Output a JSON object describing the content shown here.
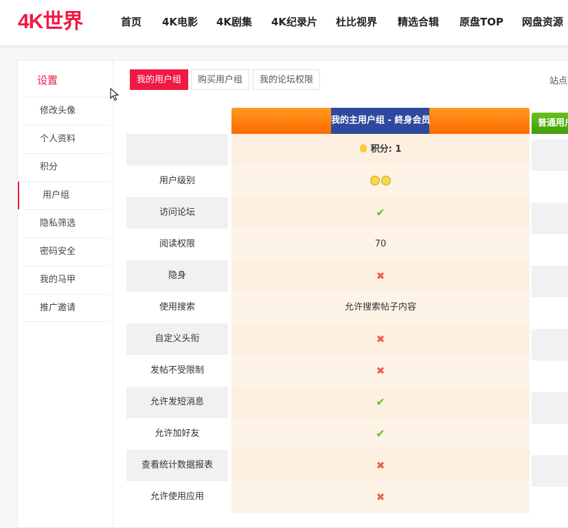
{
  "header": {
    "logo": "4K世界",
    "nav": [
      "首页",
      "4K电影",
      "4K剧集",
      "4K纪录片",
      "杜比视界",
      "精选合辑",
      "原盘TOP",
      "网盘资源"
    ]
  },
  "sidebar": {
    "title": "设置",
    "items": [
      "修改头像",
      "个人资料",
      "积分",
      "用户组",
      "隐私筛选",
      "密码安全",
      "我的马甲",
      "推广邀请"
    ],
    "active": "用户组"
  },
  "tabs": [
    "我的用户组",
    "购买用户组",
    "我的论坛权限"
  ],
  "site_label": "站点",
  "table": {
    "main_column_title": "我的主用户组 - 終身会员",
    "second_column_title": "普通用户",
    "points_label": "积分: 1",
    "rows": [
      {
        "label": "用户级别",
        "value": "smiley"
      },
      {
        "label": "访问论坛",
        "value": "check"
      },
      {
        "label": "阅读权限",
        "value": "70"
      },
      {
        "label": "隐身",
        "value": "cross"
      },
      {
        "label": "使用搜索",
        "value": "允许搜索帖子内容"
      },
      {
        "label": "自定义头衔",
        "value": "cross"
      },
      {
        "label": "发帖不受限制",
        "value": "cross"
      },
      {
        "label": "允许发短消息",
        "value": "check"
      },
      {
        "label": "允许加好友",
        "value": "check"
      },
      {
        "label": "查看统计数据报表",
        "value": "cross"
      },
      {
        "label": "允许使用应用",
        "value": "cross"
      }
    ]
  },
  "colors": {
    "accent": "#f01a44",
    "header_orange": "#ff7a00",
    "title_blue": "#2e4a9e",
    "green": "#4aa80c"
  }
}
